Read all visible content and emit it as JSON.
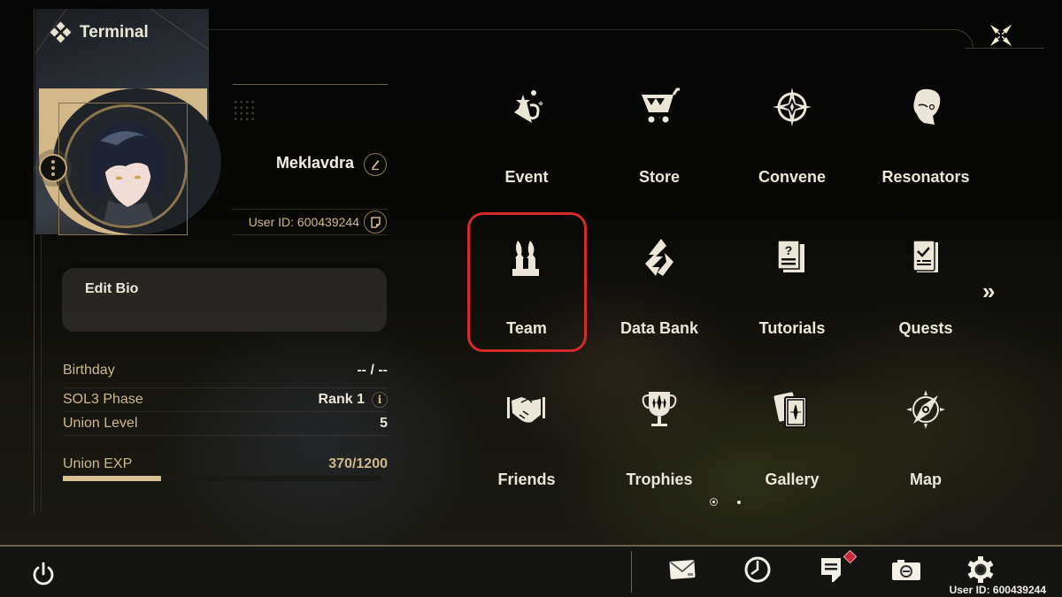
{
  "header": {
    "title": "Terminal"
  },
  "profile": {
    "player_name": "Meklavdra",
    "user_id": "User ID: 600439244",
    "bio_label": "Edit Bio"
  },
  "stats": {
    "birthday_label": "Birthday",
    "birthday_value": "-- / --",
    "sol3_label": "SOL3 Phase",
    "sol3_value": "Rank 1",
    "union_level_label": "Union Level",
    "union_level_value": "5",
    "union_exp_label": "Union EXP",
    "union_exp_value": "370/1200",
    "union_exp_current": 370,
    "union_exp_max": 1200
  },
  "menu": {
    "items": [
      {
        "label": "Event",
        "icon": "event-icon"
      },
      {
        "label": "Store",
        "icon": "store-icon"
      },
      {
        "label": "Convene",
        "icon": "convene-icon"
      },
      {
        "label": "Resonators",
        "icon": "resonators-icon"
      },
      {
        "label": "Team",
        "icon": "team-icon",
        "highlighted": true
      },
      {
        "label": "Data Bank",
        "icon": "data-bank-icon"
      },
      {
        "label": "Tutorials",
        "icon": "tutorials-icon"
      },
      {
        "label": "Quests",
        "icon": "quests-icon"
      },
      {
        "label": "Friends",
        "icon": "friends-icon"
      },
      {
        "label": "Trophies",
        "icon": "trophies-icon"
      },
      {
        "label": "Gallery",
        "icon": "gallery-icon"
      },
      {
        "label": "Map",
        "icon": "map-icon"
      }
    ],
    "next_page": "»",
    "page_count": 2,
    "current_page": 1
  },
  "bottom_bar": {
    "icons": [
      "power-icon",
      "mail-icon",
      "clock-icon",
      "notice-icon",
      "camera-icon",
      "settings-icon"
    ],
    "user_id": "User ID: 600439244"
  },
  "colors": {
    "gold": "#cfb88c",
    "text": "#ece6d8",
    "highlight": "#d42a2a",
    "alert": "#c5283e"
  }
}
